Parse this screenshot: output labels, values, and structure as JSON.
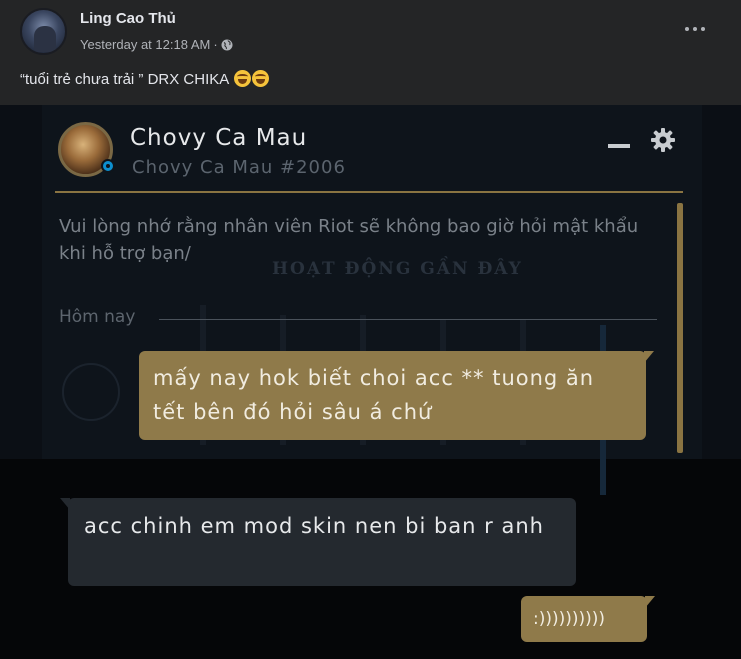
{
  "post": {
    "author": "Ling Cao Thủ",
    "timestamp": "Yesterday at 12:18 AM",
    "separator": "·",
    "audience_icon": "globe-icon",
    "caption": "“tuổi trẻ chưa trải ” DRX CHIKA",
    "caption_emojis": [
      "grinning-squinting-face",
      "grinning-squinting-face"
    ]
  },
  "chat": {
    "profile_name": "Chovy Ca Mau",
    "profile_tag": "Chovy Ca Mau #2006",
    "notice": "Vui lòng nhớ rằng nhân viên Riot sẽ không bao giờ hỏi mật khẩu khi hỗ trợ bạn/",
    "day_label": "Hôm nay",
    "background_text": "HOẠT ĐỘNG GẦN ĐÂY",
    "messages": [
      {
        "from": "me",
        "text": "mấy nay hok biết choi acc ** tuong ăn tết bên đó hỏi sâu á chứ"
      },
      {
        "from": "other",
        "text": "acc chinh em mod skin nen bi ban r anh"
      },
      {
        "from": "me",
        "text": ":))))))))))"
      }
    ],
    "colors": {
      "accent_gold": "#8f7a4a",
      "incoming_bubble": "#24292f",
      "panel_bg": "#0e141b",
      "status_blue": "#0d8fcf"
    }
  }
}
